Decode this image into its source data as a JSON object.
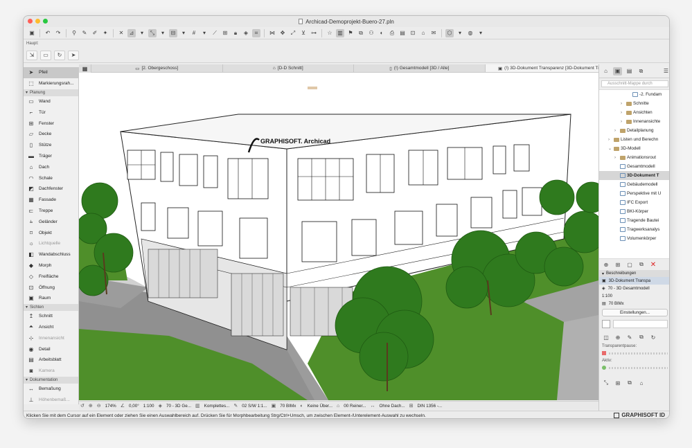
{
  "window": {
    "title": "Archicad-Demoprojekt-Buero-27.pln"
  },
  "toolbar_label": "Haupt:",
  "tabs": [
    {
      "label": "[2. Obergeschoss]",
      "icon": "floor-plan-icon"
    },
    {
      "label": "[D-D Schnitt]",
      "icon": "section-icon"
    },
    {
      "label": "(!) Gesamtmodell [3D / Alle]",
      "icon": "3d-icon"
    },
    {
      "label": "(!) 3D-Dokument Transparenz [3D-Dokument Tr...",
      "icon": "3d-document-icon"
    }
  ],
  "toolbox": {
    "top": [
      {
        "label": "Pfeil",
        "icon": "arrow-icon",
        "selected": true
      },
      {
        "label": "Markierungsrah...",
        "icon": "marquee-icon"
      }
    ],
    "sections": [
      {
        "title": "Planung",
        "items": [
          {
            "label": "Wand",
            "icon": "wall-icon"
          },
          {
            "label": "Tür",
            "icon": "door-icon"
          },
          {
            "label": "Fenster",
            "icon": "window-icon"
          },
          {
            "label": "Decke",
            "icon": "slab-icon"
          },
          {
            "label": "Stütze",
            "icon": "column-icon"
          },
          {
            "label": "Träger",
            "icon": "beam-icon"
          },
          {
            "label": "Dach",
            "icon": "roof-icon"
          },
          {
            "label": "Schale",
            "icon": "shell-icon"
          },
          {
            "label": "Dachfenster",
            "icon": "skylight-icon"
          },
          {
            "label": "Fassade",
            "icon": "curtain-wall-icon"
          },
          {
            "label": "Treppe",
            "icon": "stair-icon"
          },
          {
            "label": "Geländer",
            "icon": "railing-icon"
          },
          {
            "label": "Objekt",
            "icon": "object-icon"
          },
          {
            "label": "Lichtquelle",
            "icon": "lamp-icon",
            "dim": true
          },
          {
            "label": "Wandabschluss",
            "icon": "wall-end-icon"
          },
          {
            "label": "Morph",
            "icon": "morph-icon"
          },
          {
            "label": "Freifläche",
            "icon": "mesh-icon"
          },
          {
            "label": "Öffnung",
            "icon": "opening-icon"
          },
          {
            "label": "Raum",
            "icon": "zone-icon"
          }
        ]
      },
      {
        "title": "Sichten",
        "items": [
          {
            "label": "Schnitt",
            "icon": "section-tool-icon"
          },
          {
            "label": "Ansicht",
            "icon": "elevation-icon"
          },
          {
            "label": "Innenansicht",
            "icon": "interior-elevation-icon",
            "dim": true
          },
          {
            "label": "Detail",
            "icon": "detail-icon"
          },
          {
            "label": "Arbeitsblatt",
            "icon": "worksheet-icon"
          },
          {
            "label": "Kamera",
            "icon": "camera-icon",
            "dim": true
          }
        ]
      },
      {
        "title": "Dokumentation",
        "items": [
          {
            "label": "Bemaßung",
            "icon": "dimension-icon"
          },
          {
            "label": "Höhenbemaß...",
            "icon": "level-dimension-icon",
            "dim": true
          }
        ]
      }
    ]
  },
  "navigator": {
    "search_placeholder": "Ausschnitt-Mappe durch",
    "nodes": [
      {
        "label": "-2. Fundam",
        "depth": 4,
        "type": "view"
      },
      {
        "label": "Schnitte",
        "depth": 3,
        "type": "folder",
        "arrow": "›"
      },
      {
        "label": "Ansichten",
        "depth": 3,
        "type": "folder",
        "arrow": "›"
      },
      {
        "label": "Innenansichte",
        "depth": 3,
        "type": "folder",
        "arrow": "›"
      },
      {
        "label": "Detailplanung",
        "depth": 2,
        "type": "folder",
        "arrow": "›"
      },
      {
        "label": "Listen und Berechn",
        "depth": 1,
        "type": "folder",
        "arrow": "›"
      },
      {
        "label": "3D-Modell",
        "depth": 1,
        "type": "folder",
        "arrow": "⌄"
      },
      {
        "label": "Animationsrout",
        "depth": 2,
        "type": "folder",
        "arrow": "›"
      },
      {
        "label": "Gesamtmodell",
        "depth": 2,
        "type": "view"
      },
      {
        "label": "3D-Dokument T",
        "depth": 2,
        "type": "view",
        "selected": true
      },
      {
        "label": "Gebäudemodell",
        "depth": 2,
        "type": "view"
      },
      {
        "label": "Perspektive mit U",
        "depth": 2,
        "type": "view"
      },
      {
        "label": "IFC Export",
        "depth": 2,
        "type": "view"
      },
      {
        "label": "BKI-Körper",
        "depth": 2,
        "type": "view"
      },
      {
        "label": "Tragende Bautei",
        "depth": 2,
        "type": "view"
      },
      {
        "label": "Tragwerksanalys",
        "depth": 2,
        "type": "view"
      },
      {
        "label": "Volumenkörper",
        "depth": 2,
        "type": "view"
      }
    ]
  },
  "properties": {
    "section_title": "Beschreibungen",
    "rows": [
      "3D-Dokument Transpa",
      "70 - 3D Gesamtmodell",
      "1:100",
      "70 BIMx"
    ],
    "settings_button": "Einstellungen...",
    "transparent_label": "Transparentpause:",
    "active_label": "Aktiv:"
  },
  "statusbar": {
    "zoom": "174%",
    "angle": "0,00°",
    "scale": "1:100",
    "layer": "70 - 3D Ge...",
    "model": "Komplettes...",
    "pen": "02 S/W 1:1...",
    "bimx": "70 BIMx",
    "override": "Keine Über...",
    "renovation": "00 Reiner...",
    "roof": "Ohne Dach...",
    "din": "DIN 1356 -..."
  },
  "help_text": "Klicken Sie mit dem Cursor auf ein Element oder ziehen Sie einen Auswahlbereich auf. Drücken Sie für Morphbearbeitung Strg/Ctrl+Umsch, um zwischen Element-/Unterelement-Auswahl zu wechseln.",
  "brand": "GRAPHISOFT ID",
  "model_view": {
    "logo_text": "GRAPHISOFT. Archicad",
    "colors": {
      "grass": "#4f8f2a",
      "tree": "#2f7a1e",
      "tree_dark": "#1f5a12",
      "paving": "#b5b5b5",
      "facade": "#ffffff"
    }
  }
}
